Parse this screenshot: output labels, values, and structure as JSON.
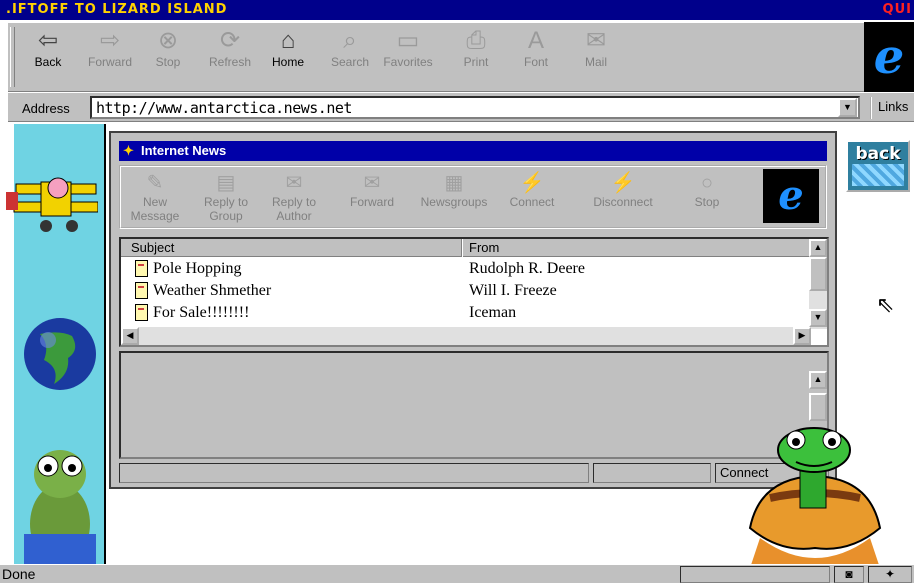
{
  "window": {
    "title": ".IFTOFF TO LIZARD ISLAND",
    "title_right": "QUI"
  },
  "toolbar": [
    {
      "label": "Back",
      "icon": "back-arrow-icon",
      "glyph": "⇦",
      "enabled": true
    },
    {
      "label": "Forward",
      "icon": "forward-arrow-icon",
      "glyph": "⇨",
      "enabled": false
    },
    {
      "label": "Stop",
      "icon": "stop-icon",
      "glyph": "⊗",
      "enabled": false
    },
    {
      "label": "Refresh",
      "icon": "refresh-icon",
      "glyph": "⟳",
      "enabled": false
    },
    {
      "label": "Home",
      "icon": "home-icon",
      "glyph": "⌂",
      "enabled": true
    },
    {
      "label": "Search",
      "icon": "search-icon",
      "glyph": "⌕",
      "enabled": false
    },
    {
      "label": "Favorites",
      "icon": "favorites-icon",
      "glyph": "▭",
      "enabled": false
    },
    {
      "label": "Print",
      "icon": "print-icon",
      "glyph": "⎙",
      "enabled": false
    },
    {
      "label": "Font",
      "icon": "font-icon",
      "glyph": "A",
      "enabled": false
    },
    {
      "label": "Mail",
      "icon": "mail-icon",
      "glyph": "✉",
      "enabled": false
    }
  ],
  "address": {
    "label": "Address",
    "value": "http://www.antarctica.news.net",
    "links_label": "Links"
  },
  "news": {
    "title": "Internet News",
    "toolbar": [
      {
        "label": "New\nMessage",
        "icon": "new-message-icon",
        "glyph": "✎"
      },
      {
        "label": "Reply to\nGroup",
        "icon": "reply-to-group-icon",
        "glyph": "▤"
      },
      {
        "label": "Reply to\nAuthor",
        "icon": "reply-to-author-icon",
        "glyph": "✉"
      },
      {
        "label": "Forward",
        "icon": "forward-message-icon",
        "glyph": "✉"
      },
      {
        "label": "Newsgroups",
        "icon": "newsgroups-icon",
        "glyph": "▦"
      },
      {
        "label": "Connect",
        "icon": "connect-icon",
        "glyph": "⚡"
      },
      {
        "label": "Disconnect",
        "icon": "disconnect-icon",
        "glyph": "⚡"
      },
      {
        "label": "Stop",
        "icon": "stop-icon",
        "glyph": "○"
      }
    ],
    "columns": {
      "subject": "Subject",
      "from": "From"
    },
    "messages": [
      {
        "subject": "Pole Hopping",
        "from": "Rudolph R. Deere"
      },
      {
        "subject": "Weather Shmether",
        "from": "Will I. Freeze"
      },
      {
        "subject": "For Sale!!!!!!!!",
        "from": "Iceman"
      }
    ],
    "status": {
      "connect": "Connect"
    }
  },
  "side": {
    "back_label": "back"
  },
  "statusbar": {
    "text": "Done"
  }
}
